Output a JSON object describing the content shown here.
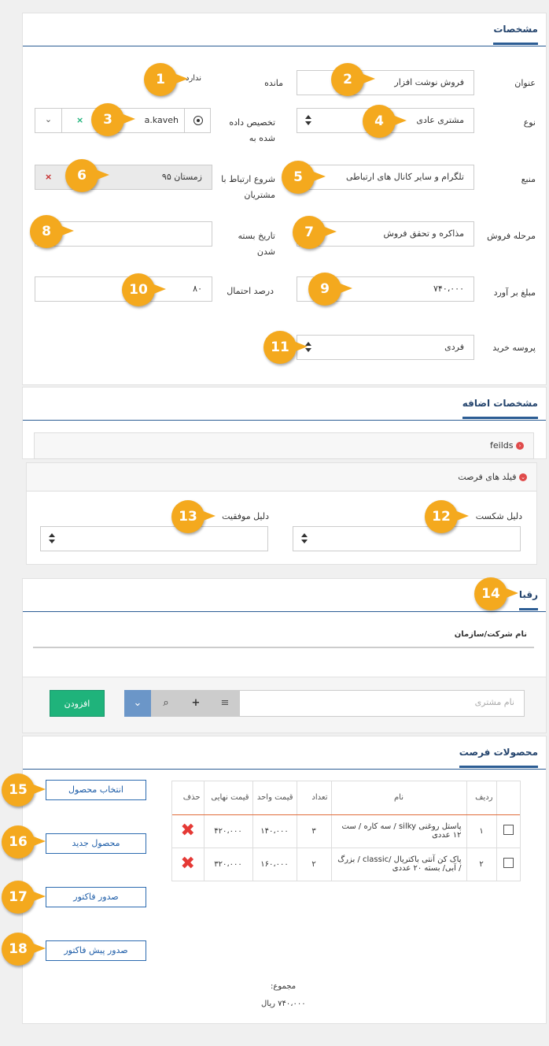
{
  "details": {
    "title": "مشخصات",
    "fields": {
      "title_label": "عنوان",
      "title_value": "فروش نوشت افزار",
      "remaining_label": "مانده",
      "remaining_value": "ندارد",
      "type_label": "نوع",
      "type_value": "مشتری عادی",
      "assigned_label": "تخصیص داده شده به",
      "assigned_value": "a.kaveh",
      "source_label": "منبع",
      "source_value": "تلگرام و سایر کانال های ارتباطی",
      "start_label": "شروع ارتباط با مشتریان",
      "start_value": "زمستان ۹۵",
      "stage_label": "مرحله فروش",
      "stage_value": "مذاکره و تحقق فروش",
      "close_date_label": "تاریخ بسته شدن",
      "close_date_value": "",
      "estimate_label": "مبلغ بر آورد",
      "estimate_value": "۷۴۰،۰۰۰",
      "probability_label": "درصد احتمال",
      "probability_value": "۸۰",
      "purchase_process_label": "پروسه خرید",
      "purchase_process_value": "فردی"
    }
  },
  "extra": {
    "title": "مشخصات اضافه",
    "feilds_label": "feilds",
    "opportunity_fields_label": "فیلد های فرصت",
    "fail_reason_label": "دلیل شکست",
    "success_reason_label": "دلیل موفقیت"
  },
  "competitors": {
    "title": "رقبا",
    "column_label": "نام شرکت/سازمان",
    "customer_placeholder": "نام مشتری",
    "add_button": "افزودن"
  },
  "products": {
    "title": "محصولات فرصت",
    "buttons": {
      "select_product": "انتخاب محصول",
      "new_product": "محصول جدید",
      "issue_invoice": "صدور فاکتور",
      "issue_proforma": "صدور پیش فاکتور"
    },
    "table": {
      "headers": {
        "row": "ردیف",
        "name": "نام",
        "qty": "تعداد",
        "unit_price": "قیمت واحد",
        "final_price": "قیمت نهایی",
        "delete": "حذف"
      },
      "rows": [
        {
          "row": "۱",
          "name": "پاستل روغنی silky / سه کاره / ست ۱۲ عددی",
          "qty": "۳",
          "unit_price": "۱۴۰،۰۰۰",
          "final_price": "۴۲۰،۰۰۰"
        },
        {
          "row": "۲",
          "name": "پاک کن آنتی باکتریال /classic / بزرگ / آبی/ بسته ۲۰ عددی",
          "qty": "۲",
          "unit_price": "۱۶۰،۰۰۰",
          "final_price": "۳۲۰،۰۰۰"
        }
      ]
    },
    "total_label": "مجموع:",
    "total_value": "۷۴۰،۰۰۰ ریال"
  },
  "callouts": [
    "1",
    "2",
    "3",
    "4",
    "5",
    "6",
    "7",
    "8",
    "9",
    "10",
    "11",
    "12",
    "13",
    "14",
    "15",
    "16",
    "17",
    "18"
  ],
  "colors": {
    "accent": "#2c5d94",
    "callout": "#f4a91e",
    "add_button": "#1fb37b",
    "delete": "#e53935"
  }
}
